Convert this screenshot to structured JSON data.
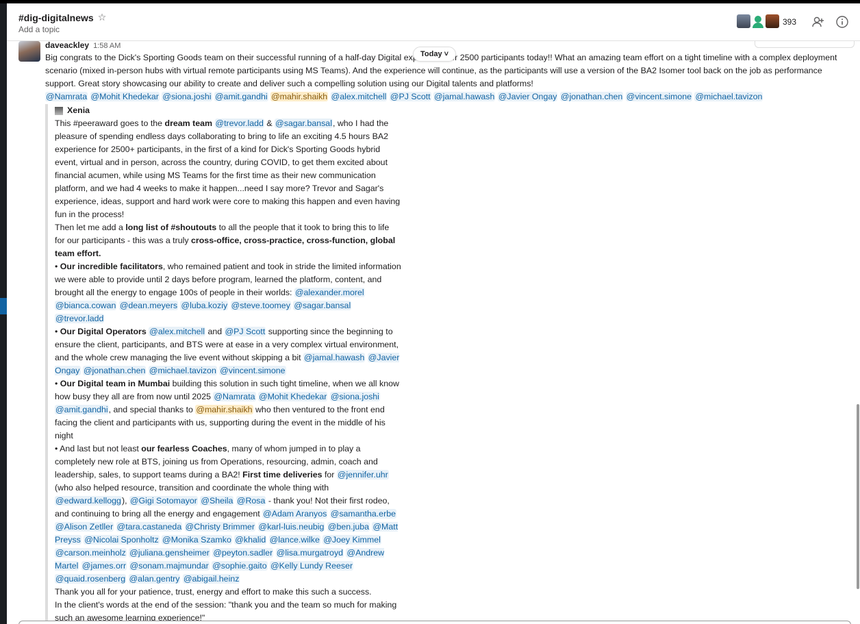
{
  "channel": {
    "name": "#dig-digitalnews",
    "topic": "Add a topic",
    "member_count": "393"
  },
  "header_icons": {
    "star": "star-icon",
    "add_people": "add-person-icon",
    "info": "info-icon"
  },
  "date_divider": "Today ˅",
  "message": {
    "author": "daveackley",
    "time": "1:58 AM",
    "text": "Big congrats to the Dick's Sporting Goods team on their successful running of a half-day Digital experience for 2500 participants today!! What an amazing team effort on a tight timeline with a complex deployment scenario (mixed in-person hubs with virtual remote participants using MS Teams). And the experience will continue, as the participants will use a version of the BA2 Isomer tool back on the job as performance support. Great story showcasing our ability to create and deliver such a compelling solution using our Digital talents and platforms!",
    "mentions": [
      "@Namrata",
      "@Mohit Khedekar",
      "@siona.joshi",
      "@amit.gandhi",
      "@mahir.shaikh",
      "@alex.mitchell",
      "@PJ Scott",
      "@jamal.hawash",
      "@Javier Ongay",
      "@jonathan.chen",
      "@vincent.simone",
      "@michael.tavizon"
    ]
  },
  "quote": {
    "author": "Xenia",
    "p1": {
      "a": "This #peeraward goes to the ",
      "b": "dream team",
      "m1": "@trevor.ladd",
      "amp": " & ",
      "m2": "@sagar.bansal",
      "c": ", who I had the pleasure of spending endless days collaborating to bring to life an exciting 4.5 hours BA2 experience for 2500+ participants, in the first of a kind for Dick's Sporting Goods hybrid event, virtual and in person, across the country, during COVID, to get them excited about financial acumen, while using MS Teams for the first time as their new communication platform, and we had 4 weeks to make it happen...need I say more? Trevor and Sagar's experience, ideas, support and hard work were core to making this happen and even having fun in the process!"
    },
    "p2": {
      "a": "Then let me add a ",
      "b": "long list of #shoutouts",
      "c": " to all the people that it took to bring this to life for our participants - this was a truly ",
      "d": "cross-office, cross-practice, cross-function, global team effort."
    },
    "b1": {
      "bold": "Our incredible facilitators",
      "text": ", who remained patient and took in stride the limited information we were able to provide until 2 days before program, learned the platform, content, and brought all the energy to engage 100s of people in their worlds:",
      "mentions": [
        "@alexander.morel",
        "@bianca.cowan",
        "@dean.meyers",
        "@luba.koziy",
        "@steve.toomey",
        "@sagar.bansal",
        "@trevor.ladd"
      ]
    },
    "b2": {
      "bold": "Our Digital Operators",
      "m1": "@alex.mitchell",
      "and": " and ",
      "m2": "@PJ Scott",
      "text": " supporting since the beginning to ensure the client, participants, and BTS were at ease in a very complex virtual environment, and the whole crew managing the live event without skipping a bit",
      "mentions": [
        "@jamal.hawash",
        "@Javier Ongay",
        "@jonathan.chen",
        "@michael.tavizon",
        "@vincent.simone"
      ]
    },
    "b3": {
      "bold": "Our Digital team in Mumbai",
      "text": " building this solution in such tight timeline, when we all know how busy they all are from now until 2025",
      "mentions": [
        "@Namrata",
        "@Mohit Khedekar",
        "@siona.joshi",
        "@amit.gandhi"
      ],
      "mid": ", and special thanks to ",
      "m_me": "@mahir.shaikh",
      "end": " who then ventured to the front end facing the client and participants with us, supporting during the event in the middle of his night"
    },
    "b4": {
      "a": "And last but not least ",
      "bold1": "our fearless Coaches",
      "b": ", many of whom jumped in to play a completely new role at BTS, joining us from Operations, resourcing, admin, coach and leadership, sales, to support teams during a BA2! ",
      "bold2": "First time deliveries",
      "c": " for",
      "m_jen": "@jennifer.uhr",
      "d": " (who also helped resource, transition and coordinate the whole thing with ",
      "m_ed": "@edward.kellogg",
      "e": "), ",
      "mentions_a": [
        "@Gigi Sotomayor",
        "@Sheila",
        "@Rosa"
      ],
      "f": " - thank you! Not their first rodeo, and continuing to bring all the energy and engagement",
      "mentions_b": [
        "@Adam Aranyos",
        "@samantha.erbe",
        "@Alison Zetller",
        "@tara.castaneda",
        "@Christy Brimmer",
        "@karl-luis.neubig",
        "@ben.juba",
        "@Matt Preyss",
        "@Nicolai Sponholtz",
        "@Monika Szamko",
        "@khalid",
        "@lance.wilke",
        "@Joey Kimmel",
        "@carson.meinholz",
        "@juliana.gensheimer",
        "@peyton.sadler",
        "@lisa.murgatroyd",
        "@Andrew Martel",
        "@james.orr",
        "@sonam.majmundar",
        "@sophie.gaito",
        "@Kelly Lundy Reeser",
        "@quaid.rosenberg",
        "@alan.gentry",
        "@abigail.heinz"
      ]
    },
    "closing1": "Thank you all for your patience, trust, energy and effort to make this such a success.",
    "closing2": "In the client's words at the end of the session: \"thank you and the team so much for making such an awesome learning experience!\""
  }
}
